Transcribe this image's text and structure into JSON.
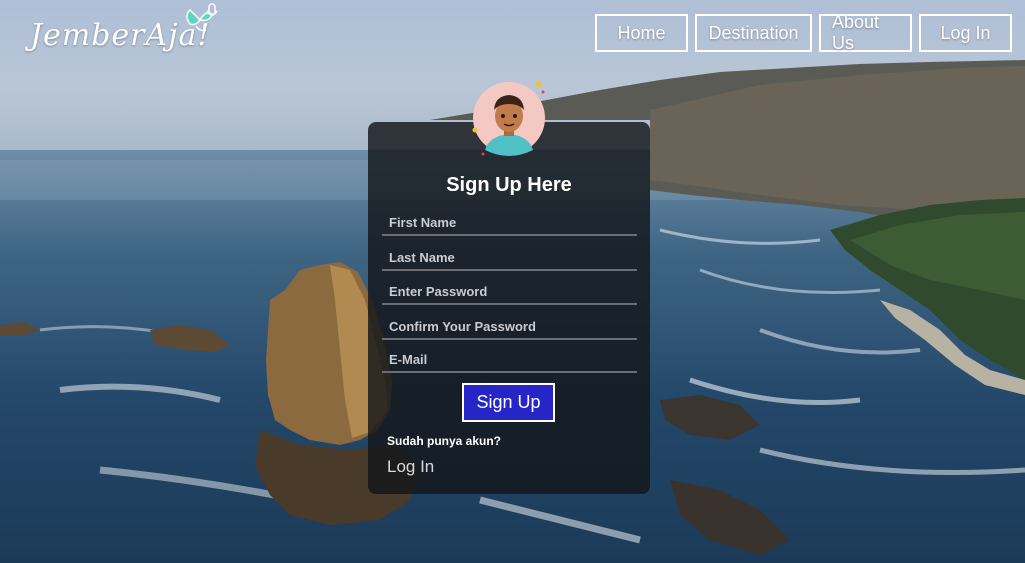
{
  "brand": {
    "name": "JemberAja!",
    "icon": "butterfly-microphone-icon"
  },
  "nav": {
    "items": [
      {
        "label": "Home"
      },
      {
        "label": "Destination"
      },
      {
        "label": "About Us"
      },
      {
        "label": "Log In"
      }
    ]
  },
  "form": {
    "avatar": "user-avatar-icon",
    "title": "Sign Up Here",
    "fields": [
      {
        "placeholder": "First Name",
        "value": ""
      },
      {
        "placeholder": "Last Name",
        "value": ""
      },
      {
        "placeholder": "Enter Password",
        "value": ""
      },
      {
        "placeholder": "Confirm Your Password",
        "value": ""
      },
      {
        "placeholder": "E-Mail",
        "value": ""
      }
    ],
    "submit_label": "Sign Up",
    "account_question": "Sudah punya akun?",
    "login_link": "Log In"
  },
  "colors": {
    "card_bg": "#14161a",
    "button_bg": "#2626c8",
    "nav_border": "#ffffff"
  }
}
